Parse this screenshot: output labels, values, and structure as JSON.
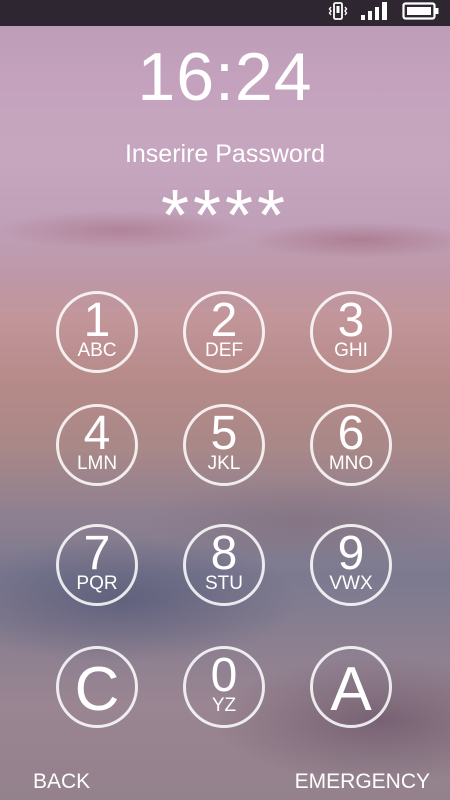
{
  "status_bar": {
    "icons": [
      "vibrate-icon",
      "signal-icon",
      "battery-icon"
    ]
  },
  "lockscreen": {
    "time": "16:24",
    "prompt": "Inserire Password",
    "masked_input": "****"
  },
  "keypad": {
    "keys": [
      {
        "digit": "1",
        "letters": "ABC"
      },
      {
        "digit": "2",
        "letters": "DEF"
      },
      {
        "digit": "3",
        "letters": "GHI"
      },
      {
        "digit": "4",
        "letters": "LMN"
      },
      {
        "digit": "5",
        "letters": "JKL"
      },
      {
        "digit": "6",
        "letters": "MNO"
      },
      {
        "digit": "7",
        "letters": "PQR"
      },
      {
        "digit": "8",
        "letters": "STU"
      },
      {
        "digit": "9",
        "letters": "VWX"
      },
      {
        "digit": "C"
      },
      {
        "digit": "0",
        "letters": "YZ"
      },
      {
        "digit": "A"
      }
    ]
  },
  "footer": {
    "back_label": "BACK",
    "emergency_label": "EMERGENCY"
  },
  "colors": {
    "text": "#ffffff",
    "status_bar_bg": "#2e2630"
  }
}
